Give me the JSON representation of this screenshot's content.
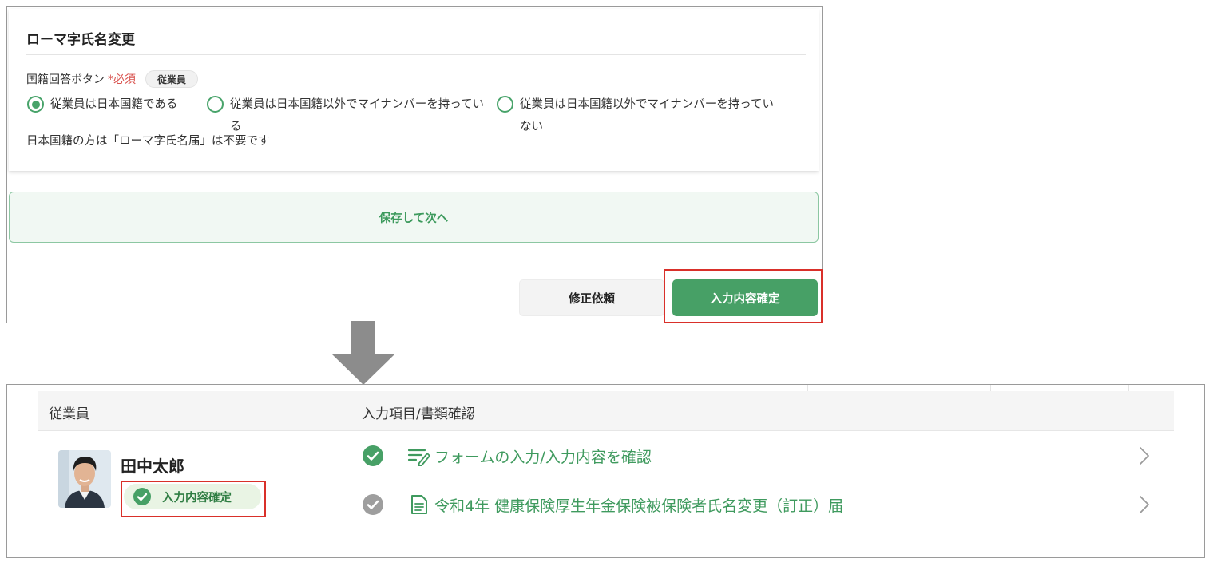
{
  "form": {
    "section_title": "ローマ字氏名変更",
    "field_label": "国籍回答ボタン",
    "required_mark": "*必須",
    "role_tag": "従業員",
    "options": [
      {
        "label": "従業員は日本国籍である",
        "selected": true
      },
      {
        "label": "従業員は日本国籍以外でマイナンバーを持っている",
        "selected": false
      },
      {
        "label": "従業員は日本国籍以外でマイナンバーを持っていない",
        "selected": false
      }
    ],
    "note": "日本国籍の方は「ローマ字氏名届」は不要です",
    "save_next_label": "保存して次へ",
    "revise_label": "修正依頼",
    "confirm_label": "入力内容確定"
  },
  "table": {
    "columns": [
      "従業員",
      "入力項目/書類確認"
    ],
    "employee": {
      "name": "田中太郎",
      "status": "入力内容確定"
    },
    "tasks": [
      {
        "label": "フォームの入力/入力内容を確認",
        "status": "done",
        "icon": "form-edit-icon"
      },
      {
        "label": "令和4年 健康保険厚生年金保険被保険者氏名変更（訂正）届",
        "status": "pending",
        "icon": "document-icon"
      }
    ]
  },
  "colors": {
    "brand_green": "#47a066",
    "link_green": "#3f9a5e",
    "highlight_red": "#d9302a",
    "required_red": "#d9534f",
    "pending_gray": "#9e9e9e"
  }
}
